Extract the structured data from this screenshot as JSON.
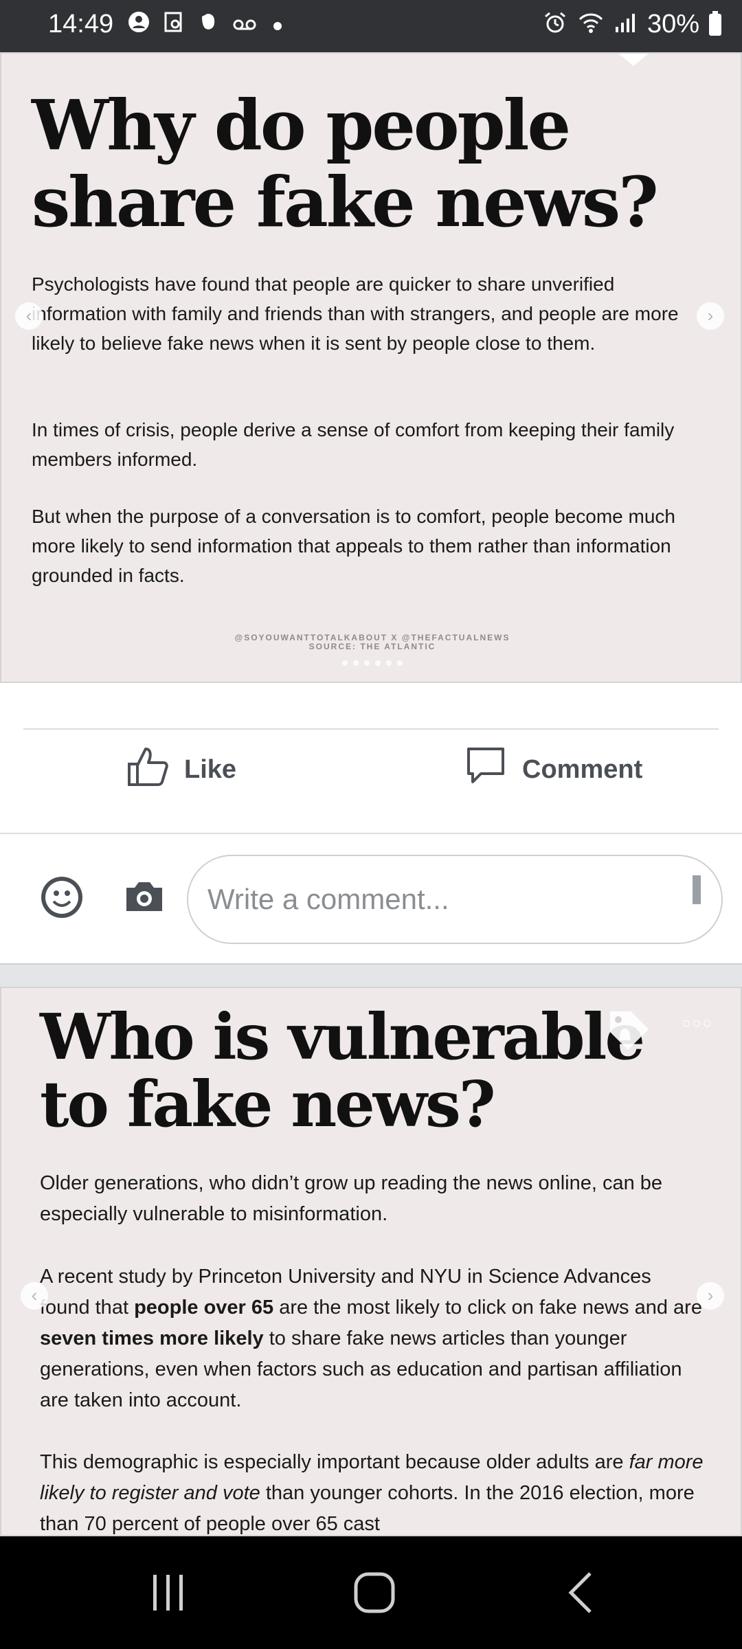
{
  "status_bar": {
    "time": "14:49",
    "battery": "30%",
    "left_icons": [
      "account-circle-icon",
      "screenshot-icon",
      "evernote-icon",
      "voicemail-icon",
      "dot-icon"
    ],
    "right_icons": [
      "alarm-icon",
      "wifi-icon",
      "signal-icon",
      "battery-icon"
    ]
  },
  "post1": {
    "headline_line1": "Why do people",
    "headline_line2": "share fake news?",
    "paragraphs": [
      "Psychologists have found that people are quicker to share unverified information with family and friends than with strangers, and people are more likely to believe fake news when it is sent by people close to them.",
      "In times of crisis, people derive a sense of comfort from keeping their family members informed.",
      "But when the purpose of a conversation is to comfort, people become much more likely to send information that appeals to them rather than information grounded in facts."
    ],
    "credit_line1": "@SOYOUWANTTOTALKABOUT X @THEFACTUALNEWS",
    "credit_line2": "SOURCE: THE ATLANTIC"
  },
  "actions": {
    "like_label": "Like",
    "comment_label": "Comment",
    "comment_placeholder": "Write a comment..."
  },
  "post2": {
    "headline_line1": "Who is vulnerable",
    "headline_line2": "to fake news?",
    "para1": "Older generations, who didn’t grow up reading the news online, can be especially vulnerable to misinformation.",
    "para2_a": "A recent study by Princeton University and NYU in Science Advances found that ",
    "para2_b": "people over 65",
    "para2_c": " are the most likely to click on fake news and are ",
    "para2_d": "seven times more likely",
    "para2_e": " to share fake news articles than younger generations, even when factors such as education and partisan affiliation are taken into account.",
    "para3_a": "This demographic is especially important because older adults are ",
    "para3_b": "far more likely to register and vote",
    "para3_c": " than younger cohorts. In the 2016 election, more than 70 percent of people over 65 cast"
  },
  "nav_bar": {
    "icons": [
      "recents-icon",
      "home-icon",
      "back-icon"
    ]
  }
}
